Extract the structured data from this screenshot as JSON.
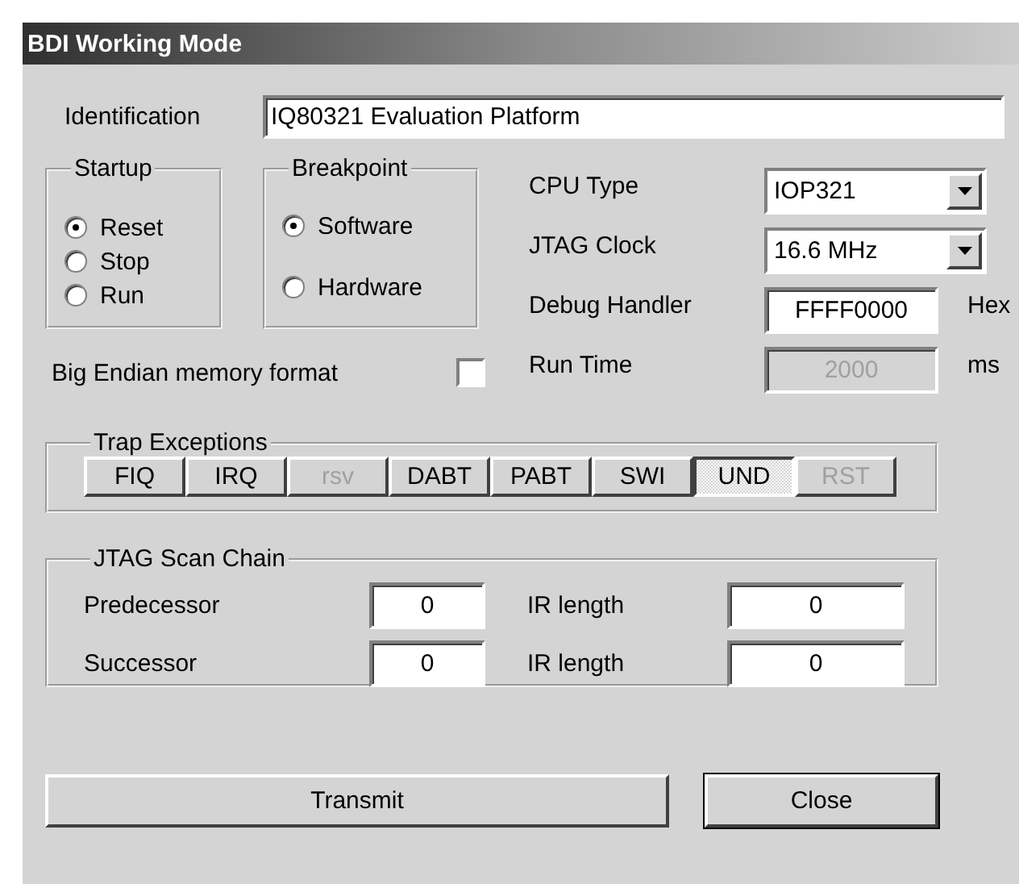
{
  "window": {
    "title": "BDI Working Mode"
  },
  "identification": {
    "label": "Identification",
    "value": "IQ80321 Evaluation Platform"
  },
  "startup": {
    "title": "Startup",
    "options": [
      {
        "label": "Reset",
        "selected": true
      },
      {
        "label": "Stop",
        "selected": false
      },
      {
        "label": "Run",
        "selected": false
      }
    ]
  },
  "breakpoint": {
    "title": "Breakpoint",
    "options": [
      {
        "label": "Software",
        "selected": true
      },
      {
        "label": "Hardware",
        "selected": false
      }
    ]
  },
  "settings": [
    {
      "kind": "select",
      "label": "CPU Type",
      "value": "IOP321"
    },
    {
      "kind": "select",
      "label": "JTAG Clock",
      "value": "16.6 MHz"
    },
    {
      "kind": "input",
      "label": "Debug Handler",
      "value": "FFFF0000",
      "unit": "Hex",
      "disabled": false
    },
    {
      "kind": "input",
      "label": "Run Time",
      "value": "2000",
      "unit": "ms",
      "disabled": true
    }
  ],
  "big_endian": {
    "label": "Big Endian memory format",
    "checked": false
  },
  "trap_exceptions": {
    "title": "Trap Exceptions",
    "buttons": [
      {
        "label": "FIQ",
        "pressed": false,
        "disabled": false
      },
      {
        "label": "IRQ",
        "pressed": false,
        "disabled": false
      },
      {
        "label": "rsv",
        "pressed": false,
        "disabled": true
      },
      {
        "label": "DABT",
        "pressed": false,
        "disabled": false
      },
      {
        "label": "PABT",
        "pressed": false,
        "disabled": false
      },
      {
        "label": "SWI",
        "pressed": false,
        "disabled": false
      },
      {
        "label": "UND",
        "pressed": true,
        "disabled": false
      },
      {
        "label": "RST",
        "pressed": false,
        "disabled": true
      }
    ]
  },
  "scan_chain": {
    "title": "JTAG Scan Chain",
    "rows": [
      {
        "label": "Predecessor",
        "value": "0",
        "ir_label": "IR length",
        "ir_value": "0"
      },
      {
        "label": "Successor",
        "value": "0",
        "ir_label": "IR length",
        "ir_value": "0"
      }
    ]
  },
  "buttons": [
    {
      "label": "Transmit",
      "default": false
    },
    {
      "label": "Close",
      "default": true
    }
  ]
}
